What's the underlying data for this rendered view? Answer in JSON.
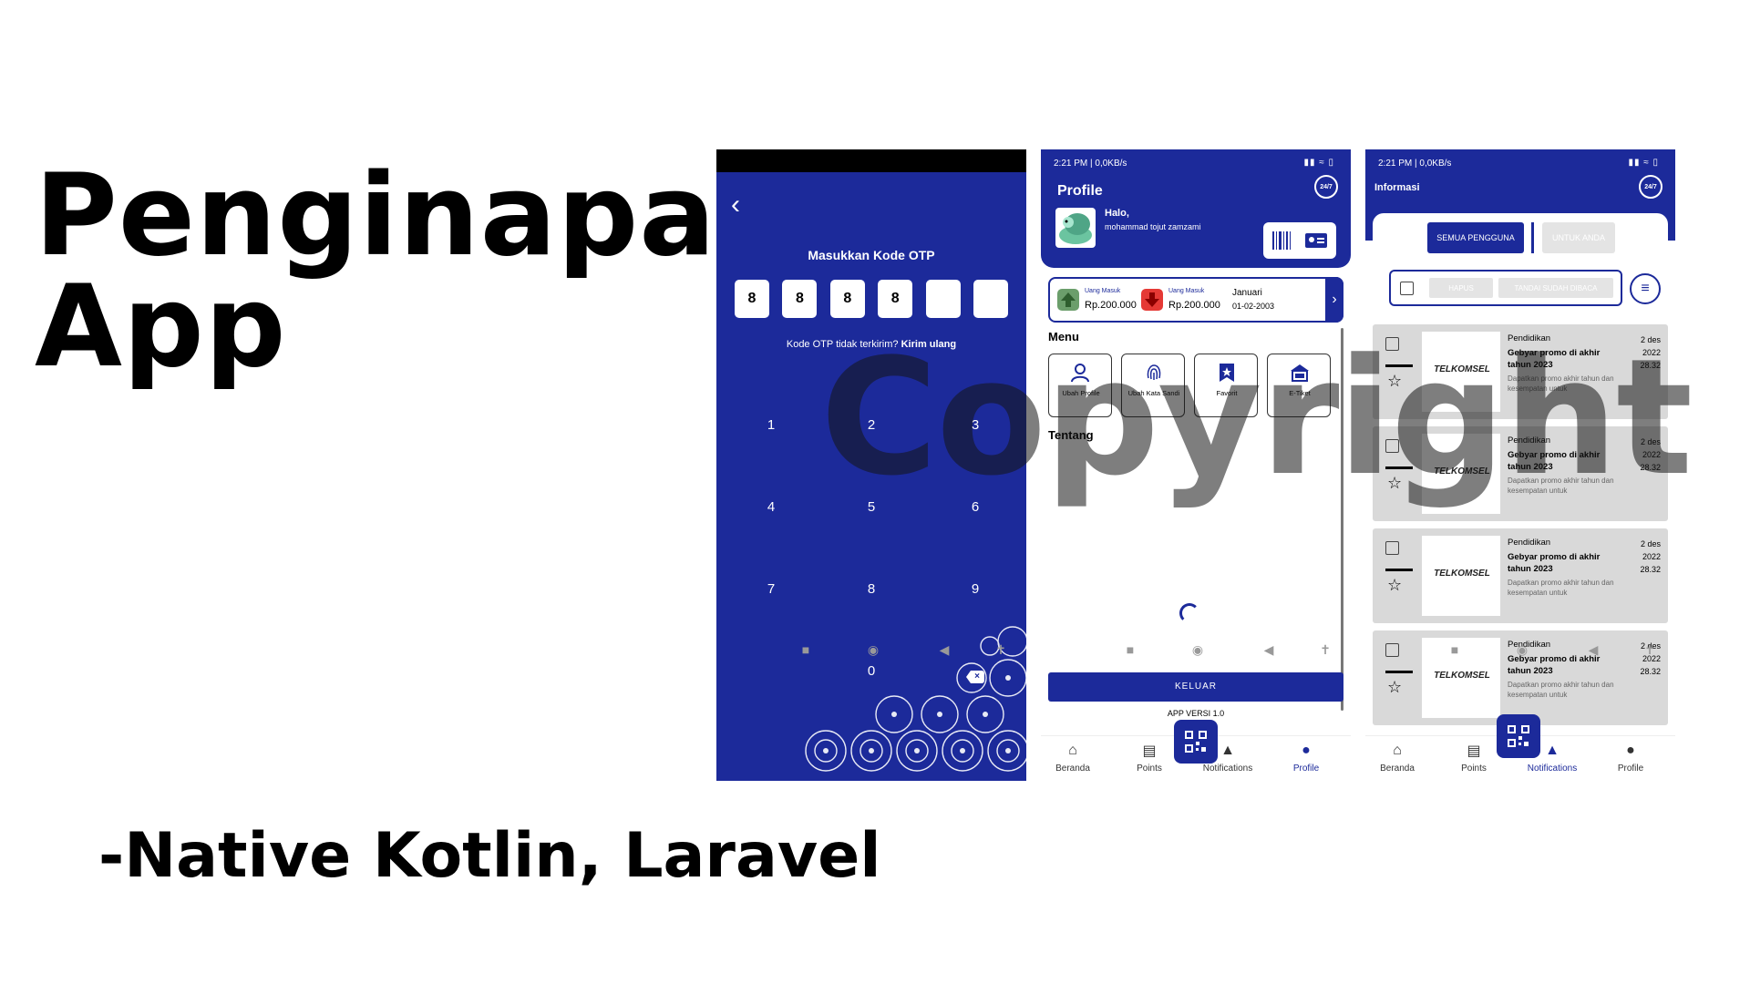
{
  "slide": {
    "title_line1": "Penginapan",
    "title_line2": "App",
    "subtitle": "-Native Kotlin, Laravel",
    "watermark": "Copyright"
  },
  "otp_screen": {
    "heading": "Masukkan Kode OTP",
    "digits": [
      "8",
      "8",
      "8",
      "8",
      "",
      ""
    ],
    "resend_text": "Kode OTP tidak terkirim?",
    "resend_link": "Kirim ulang",
    "keys": [
      "1",
      "2",
      "3",
      "4",
      "5",
      "6",
      "7",
      "8",
      "9",
      "0"
    ],
    "back_icon": "chevron-left-icon",
    "background_color": "#1c2a9a"
  },
  "profile_screen": {
    "status_time": "2:21 PM | 0,0KB/s",
    "title": "Profile",
    "greeting": "Halo,",
    "username": "mohammad tojut zamzami",
    "money": {
      "in_label": "Uang Masuk",
      "in_value": "Rp.200.000",
      "out_label": "Uang Masuk",
      "out_value": "Rp.200.000",
      "month": "Januari",
      "date": "01-02-2003"
    },
    "menu_heading": "Menu",
    "menu_items": [
      {
        "label": "Ubah Profile",
        "icon": "user-edit-icon"
      },
      {
        "label": "Ubah Kata Sandi",
        "icon": "fingerprint-icon"
      },
      {
        "label": "Favorit",
        "icon": "bookmark-star-icon"
      },
      {
        "label": "E-Tiket",
        "icon": "ticket-icon"
      }
    ],
    "about_heading": "Tentang",
    "logout_label": "KELUAR",
    "version": "APP VERSI 1.0"
  },
  "notifications_screen": {
    "status_time": "2:21 PM | 0,0KB/s",
    "title": "Informasi",
    "tabs": [
      "SEMUA PENGGUNA",
      "UNTUK ANDA"
    ],
    "actions": [
      "HAPUS",
      "TANDAI SUDAH DIBACA"
    ],
    "cards": [
      {
        "category": "Pendidikan",
        "title": "Gebyar promo di akhir tahun 2023",
        "desc": "Dapatkan promo akhir tahun dan kesempatan untuk",
        "date1": "2 des",
        "date2": "2022",
        "time": "28.32",
        "brand": "TELKOMSEL"
      },
      {
        "category": "Pendidikan",
        "title": "Gebyar promo di akhir tahun 2023",
        "desc": "Dapatkan promo akhir tahun dan kesempatan untuk",
        "date1": "2 des",
        "date2": "2022",
        "time": "28.32",
        "brand": "TELKOMSEL"
      },
      {
        "category": "Pendidikan",
        "title": "Gebyar promo di akhir tahun 2023",
        "desc": "Dapatkan promo akhir tahun dan kesempatan untuk",
        "date1": "2 des",
        "date2": "2022",
        "time": "28.32",
        "brand": "TELKOMSEL"
      },
      {
        "category": "Pendidikan",
        "title": "Gebyar promo di akhir tahun 2023",
        "desc": "Dapatkan promo akhir tahun dan kesempatan untuk",
        "date1": "2 des",
        "date2": "2022",
        "time": "28.32",
        "brand": "TELKOMSEL"
      }
    ]
  },
  "bottom_nav": [
    "Beranda",
    "Points",
    "Notifications",
    "Profile"
  ],
  "support_badge": "24/7",
  "colors": {
    "primary": "#1c2a9a",
    "down": "#e53935",
    "up": "#6b9e6b"
  }
}
